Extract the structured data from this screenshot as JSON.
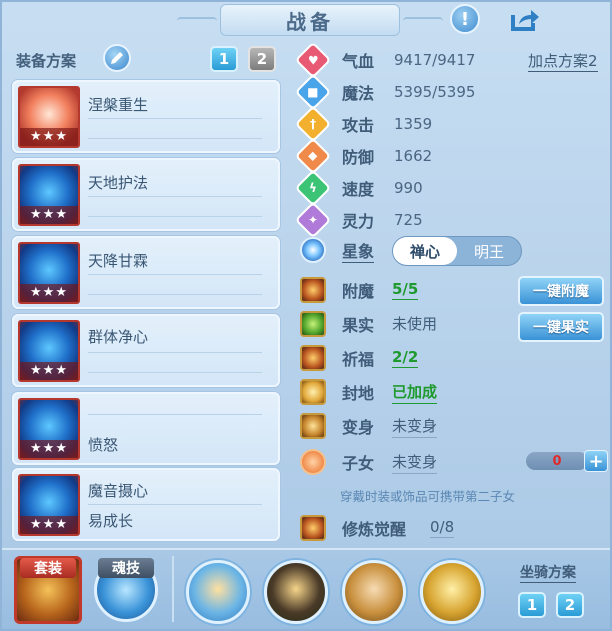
{
  "header": {
    "title": "战备"
  },
  "left": {
    "scheme_label": "装备方案",
    "scheme_tabs": [
      "1",
      "2"
    ],
    "items": [
      {
        "name": "涅槃重生",
        "sub": "",
        "stars": "★★★"
      },
      {
        "name": "天地护法",
        "sub": "",
        "stars": "★★★"
      },
      {
        "name": "天降甘霖",
        "sub": "",
        "stars": "★★★"
      },
      {
        "name": "群体净心",
        "sub": "",
        "stars": "★★★"
      },
      {
        "name": "",
        "sub": "愤怒",
        "stars": "★★★"
      },
      {
        "name": "魔音摄心",
        "sub": "易成长",
        "stars": "★★★"
      }
    ]
  },
  "stats": {
    "plan_link": "加点方案2",
    "rows": [
      {
        "label": "气血",
        "value": "9417/9417",
        "color": "#e85a74"
      },
      {
        "label": "魔法",
        "value": "5395/5395",
        "color": "#4aa4ea"
      },
      {
        "label": "攻击",
        "value": "1359",
        "color": "#f3b02e"
      },
      {
        "label": "防御",
        "value": "1662",
        "color": "#f08a4a"
      },
      {
        "label": "速度",
        "value": "990",
        "color": "#3cc476"
      },
      {
        "label": "灵力",
        "value": "725",
        "color": "#b07ad8"
      }
    ],
    "star": {
      "label": "星象",
      "options": [
        "禅心",
        "明王"
      ],
      "selected": "禅心"
    }
  },
  "features": [
    {
      "label": "附魔",
      "value": "5/5",
      "style": "green"
    },
    {
      "label": "果实",
      "value": "未使用",
      "style": "plain"
    },
    {
      "label": "祈福",
      "value": "2/2",
      "style": "green"
    },
    {
      "label": "封地",
      "value": "已加成",
      "style": "green"
    },
    {
      "label": "变身",
      "value": "未变身",
      "style": "normal"
    },
    {
      "label": "子女",
      "value": "未变身",
      "style": "normal"
    },
    {
      "label": "修炼觉醒",
      "value": "0/8",
      "style": "normal"
    }
  ],
  "buttons": {
    "enchant": "一键附魔",
    "fruit": "一键果实"
  },
  "children": {
    "count": "0",
    "hint": "穿戴时装或饰品可携带第二子女"
  },
  "bottom": {
    "set_label": "套装",
    "soul_label": "魂技",
    "mount_label": "坐骑方案",
    "mount_tabs": [
      "1",
      "2"
    ]
  }
}
